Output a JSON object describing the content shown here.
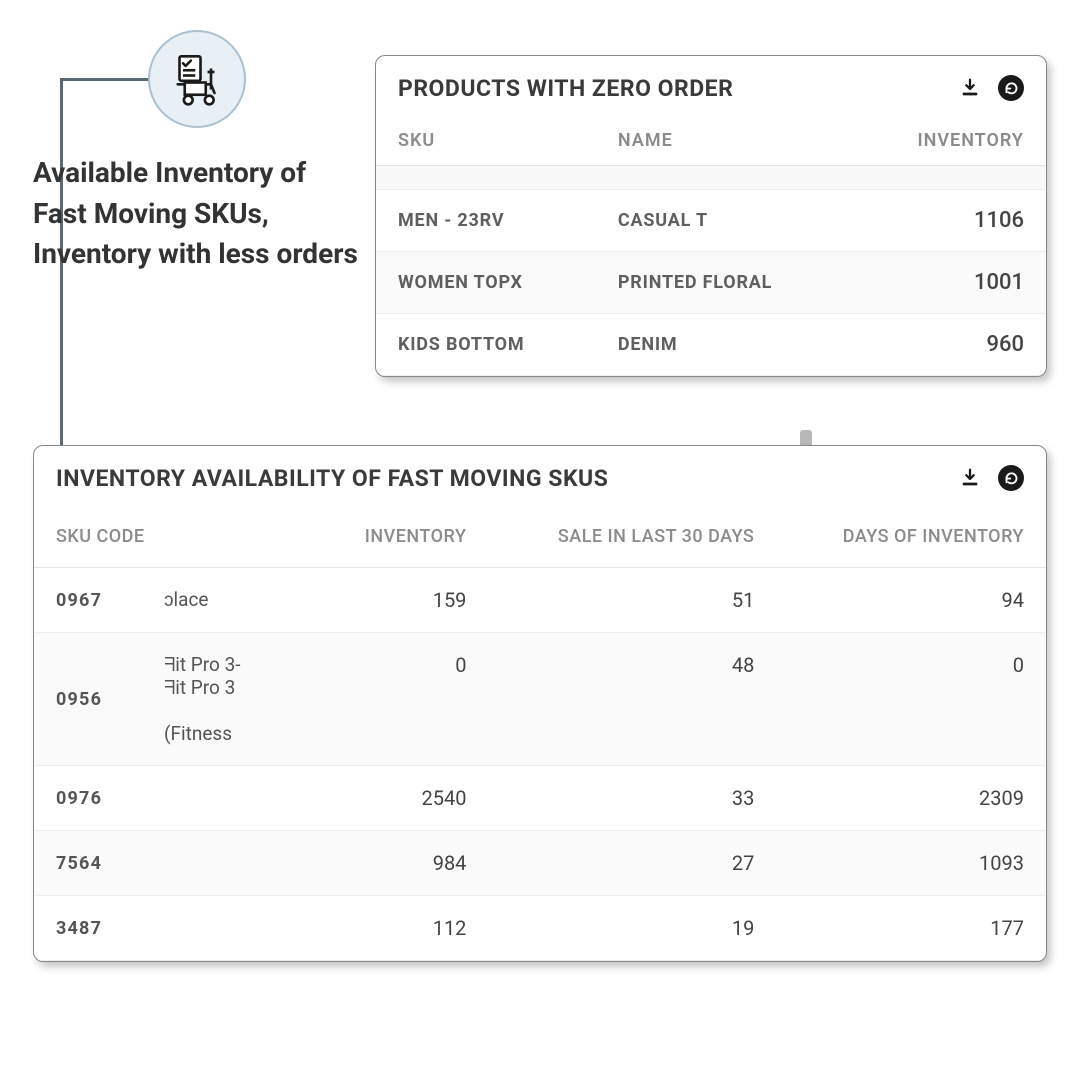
{
  "description": "Available Inventory of Fast Moving SKUs, Inventory with less orders",
  "panel_top": {
    "title": "PRODUCTS WITH ZERO ORDER",
    "columns": [
      "SKU",
      "NAME",
      "INVENTORY"
    ],
    "rows": [
      {
        "sku": "MEN - 23RV",
        "name": "CASUAL T",
        "inventory": "1106"
      },
      {
        "sku": "WOMEN TOPX",
        "name": "PRINTED FLORAL",
        "inventory": "1001"
      },
      {
        "sku": "KIDS BOTTOM",
        "name": "DENIM",
        "inventory": "960"
      }
    ]
  },
  "panel_bottom": {
    "title": "INVENTORY AVAILABILITY OF FAST MOVING SKUS",
    "columns": [
      "SKU CODE",
      "INVENTORY",
      "SALE IN LAST 30 DAYS",
      "DAYS OF INVENTORY"
    ],
    "rows": [
      {
        "sku": "0967",
        "desc": "ɔlace",
        "inventory": "159",
        "sale30": "51",
        "days": "94"
      },
      {
        "sku": "0956",
        "desc": "ᖷit Pro 3-\nᖷit Pro 3\n\n(Fitness",
        "inventory": "0",
        "sale30": "48",
        "days": "0"
      },
      {
        "sku": "0976",
        "desc": "",
        "inventory": "2540",
        "sale30": "33",
        "days": "2309"
      },
      {
        "sku": "7564",
        "desc": "",
        "inventory": "984",
        "sale30": "27",
        "days": "1093"
      },
      {
        "sku": "3487",
        "desc": "",
        "inventory": "112",
        "sale30": "19",
        "days": "177"
      }
    ]
  },
  "icons": {
    "download": "download-icon",
    "refresh": "refresh-icon",
    "cart": "cart-checklist-icon"
  }
}
